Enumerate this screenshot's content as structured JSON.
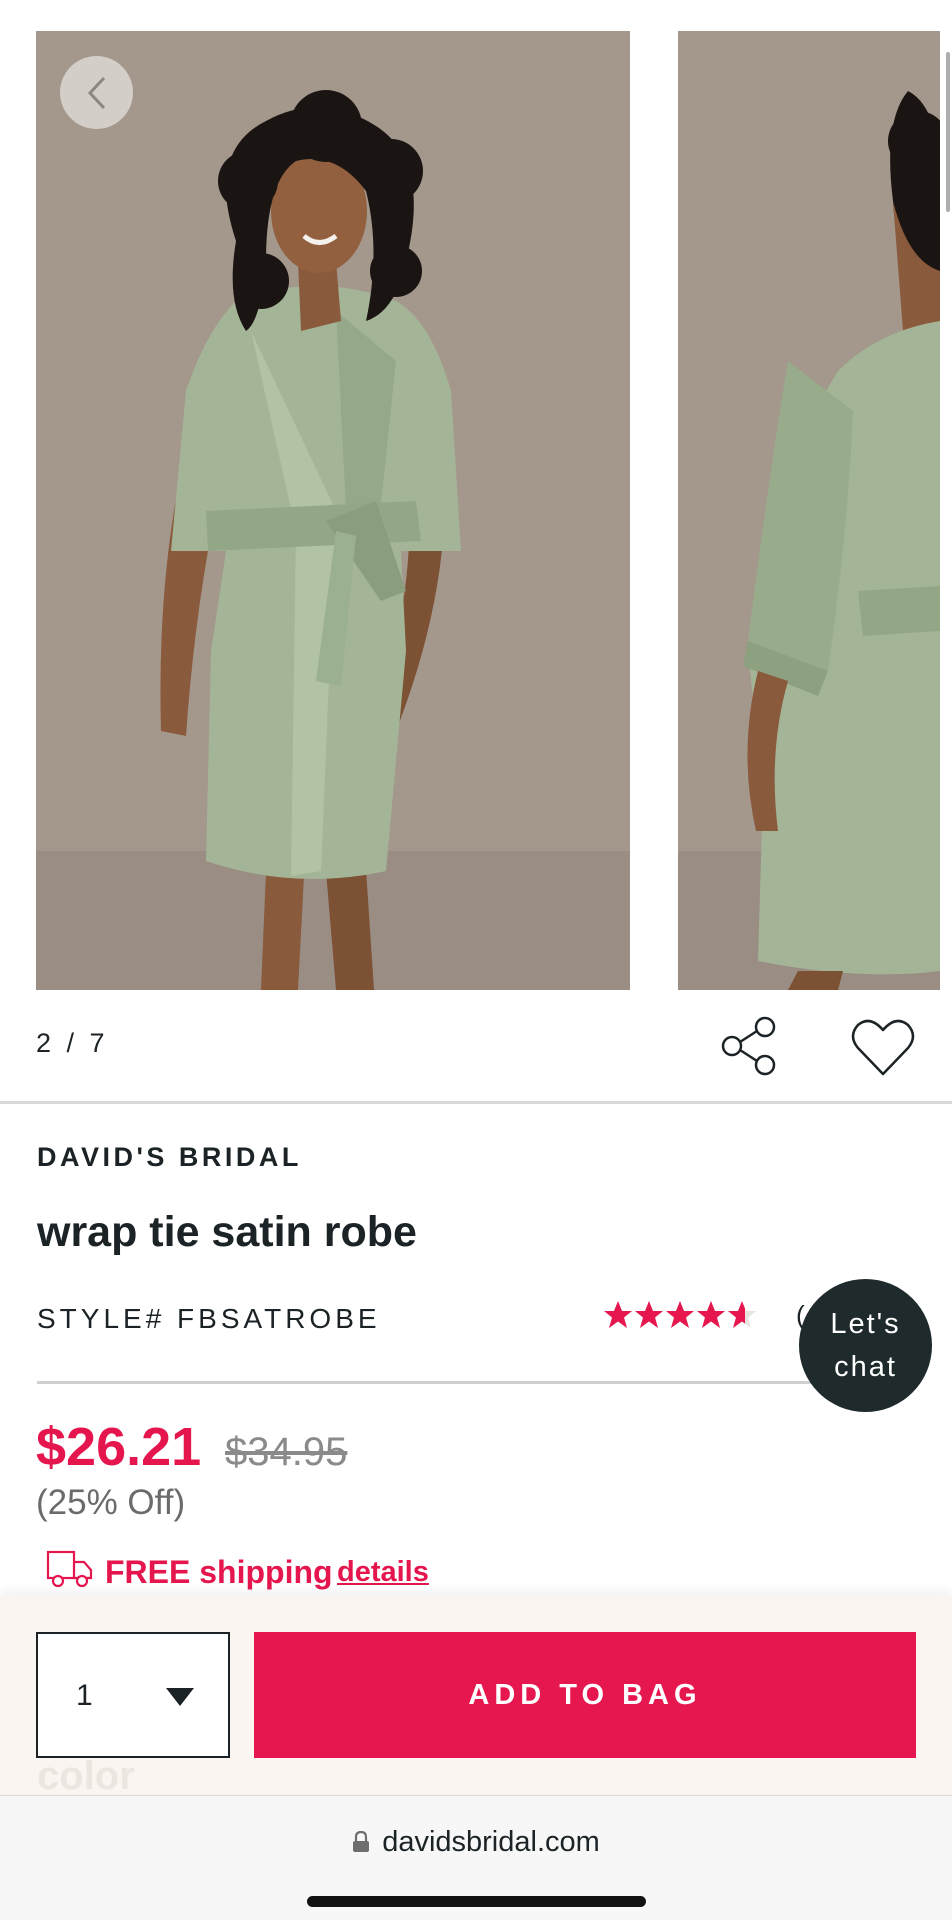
{
  "gallery": {
    "pager_text": "2 / 7",
    "back_icon": "chevron-left-icon",
    "share_icon": "share-icon",
    "wishlist_icon": "heart-icon",
    "background_color": "#a4978c"
  },
  "product": {
    "brand": "DAVID'S BRIDAL",
    "title": "wrap tie satin robe",
    "style_number": "STYLE# FBSATROBE",
    "rating": 4.6,
    "rating_max": 5,
    "rating_count_partial": "("
  },
  "chat": {
    "line1": "Let's",
    "line2": "chat"
  },
  "pricing": {
    "sale_price": "$26.21",
    "original_price": "$34.95",
    "discount": "(25% Off)",
    "shipping_label": "FREE shipping",
    "shipping_link": "details"
  },
  "purchase_bar": {
    "quantity": "1",
    "add_to_bag": "ADD TO BAG",
    "hidden_section_label": "color"
  },
  "browser": {
    "url": "davidsbridal.com"
  },
  "colors": {
    "accent": "#e5174e",
    "text": "#1c2326",
    "chat_bg": "#1e2a2c",
    "robe": "#a3b596"
  }
}
